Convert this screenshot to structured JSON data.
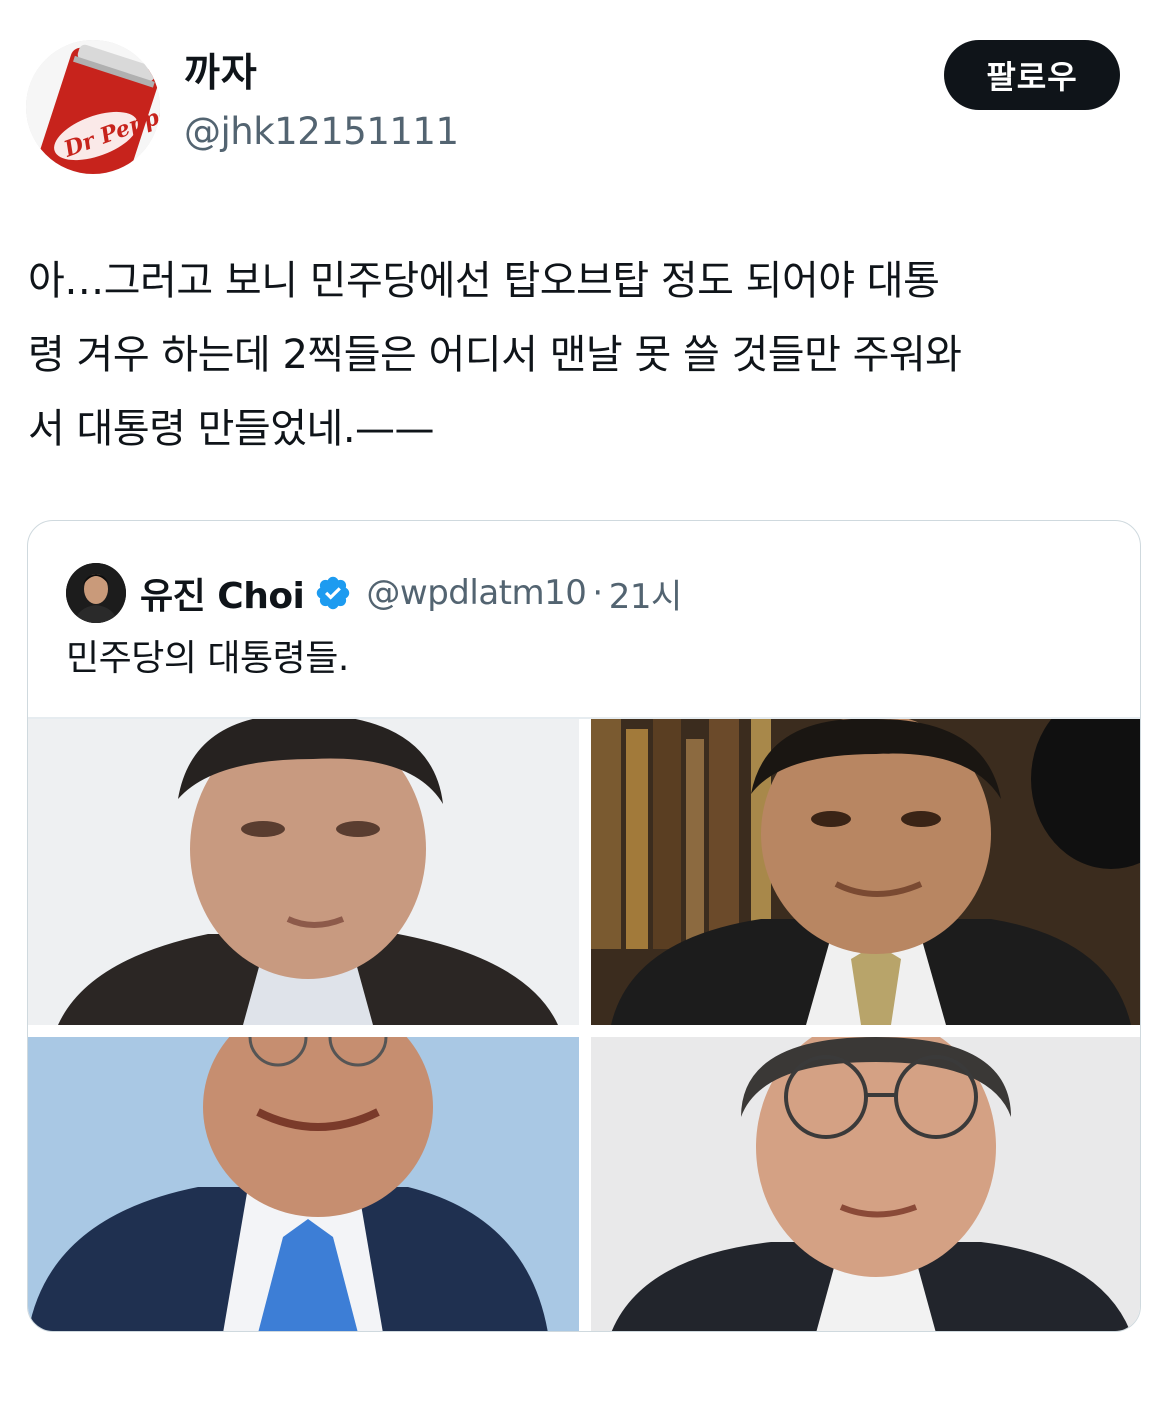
{
  "author": {
    "display_name": "까자",
    "handle": "@jhk12151111",
    "avatar_icon": "soda-can-avatar",
    "avatar_can_text": "Dr Pepper"
  },
  "follow_button": {
    "label": "팔로우"
  },
  "tweet": {
    "text": "아…그러고 보니 민주당에선 탑오브탑 정도 되어야 대통\n령 겨우 하는데 2찍들은 어디서 맨날 못 쓸 것들만 주워와\n서 대통령 만들었네.——"
  },
  "quoted_tweet": {
    "display_name": "유진 Choi",
    "verified": true,
    "handle": "@wpdlatm10",
    "separator": "·",
    "time": "21시",
    "text": "민주당의 대통령들.",
    "photos": [
      {
        "name": "portrait-photo-1",
        "bg": "#eef0f2"
      },
      {
        "name": "portrait-photo-2",
        "bg": "#4a3a2a"
      },
      {
        "name": "portrait-photo-3",
        "bg": "#a9c8e4"
      },
      {
        "name": "portrait-photo-4",
        "bg": "#e9e9ea"
      }
    ]
  },
  "colors": {
    "text_primary": "#0f1419",
    "text_secondary": "#536471",
    "verified_blue": "#1d9bf0",
    "border": "#cfd9de"
  }
}
